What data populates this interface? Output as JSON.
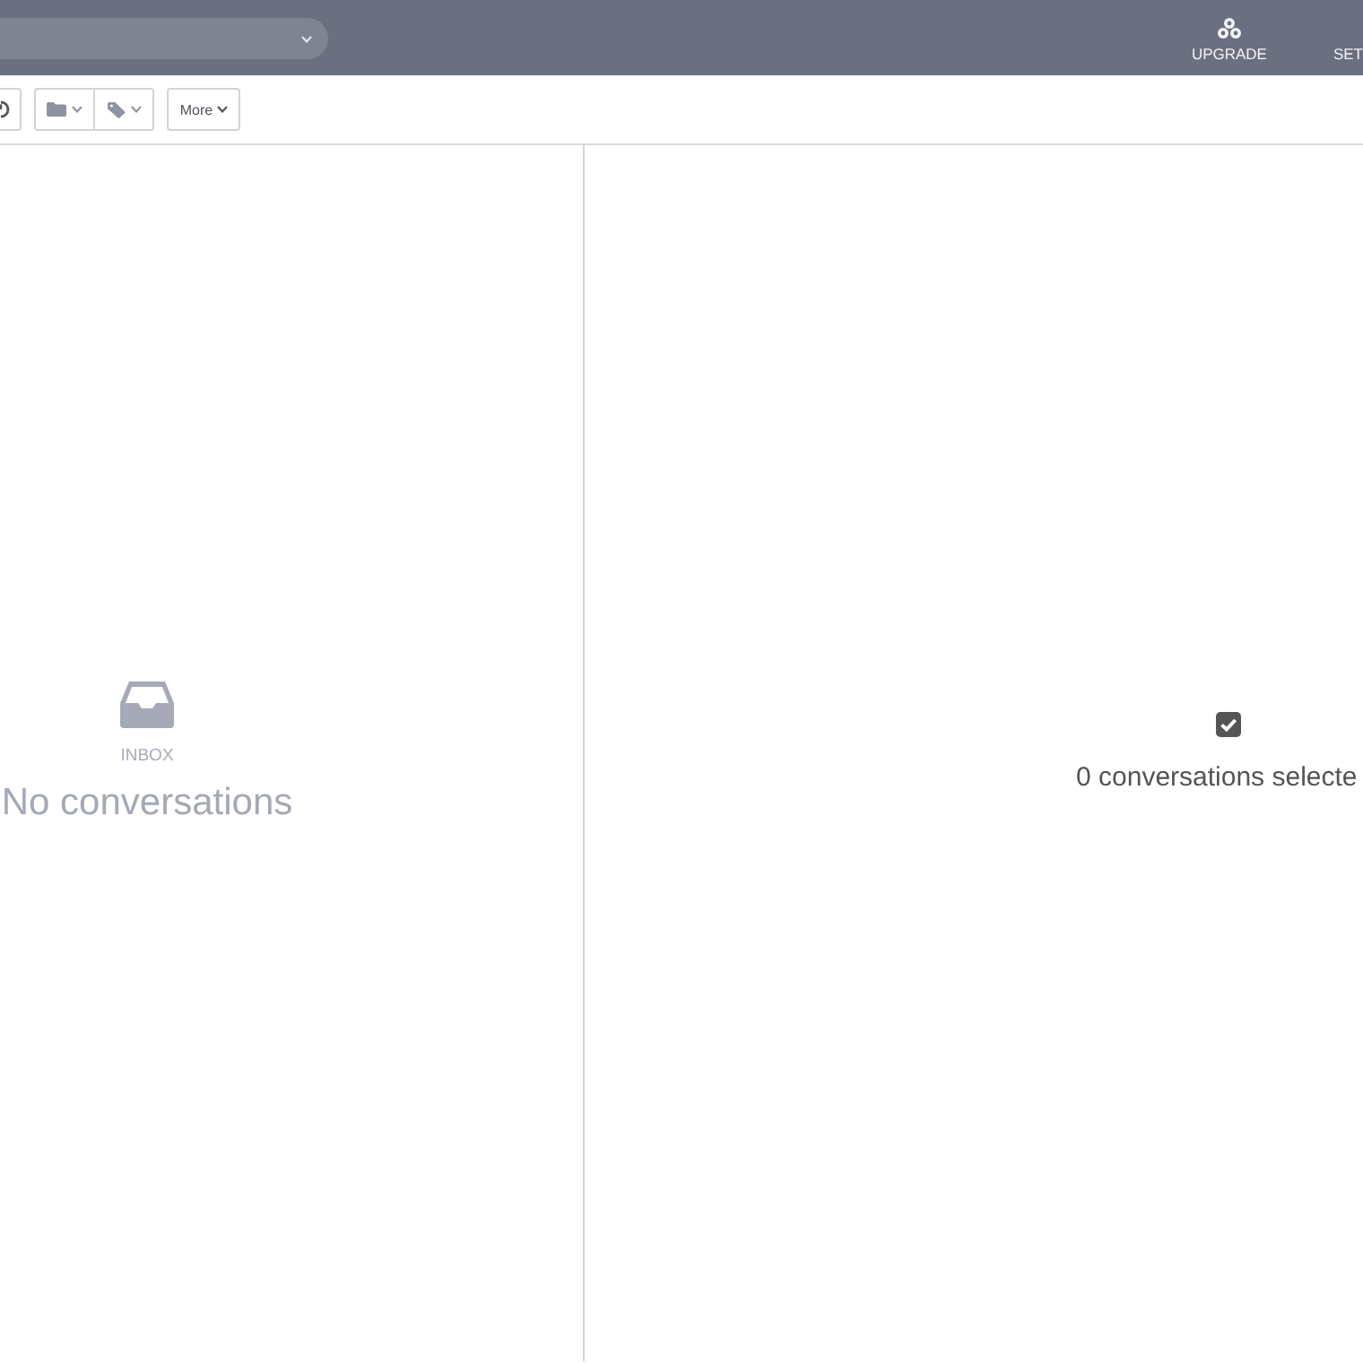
{
  "top_bar": {
    "actions": [
      {
        "kind": "upgrade",
        "label": "UPGRADE"
      },
      {
        "kind": "settings",
        "label": "SET"
      }
    ]
  },
  "toolbar": {
    "buttons": [
      {
        "kind": "refresh"
      },
      {
        "kind": "folder"
      },
      {
        "kind": "tag"
      },
      {
        "kind": "more",
        "label": "More"
      }
    ]
  },
  "list_pane": {
    "folder": "INBOX",
    "message": "No conversations"
  },
  "reading_pane": {
    "message": "0 conversations selecte"
  }
}
